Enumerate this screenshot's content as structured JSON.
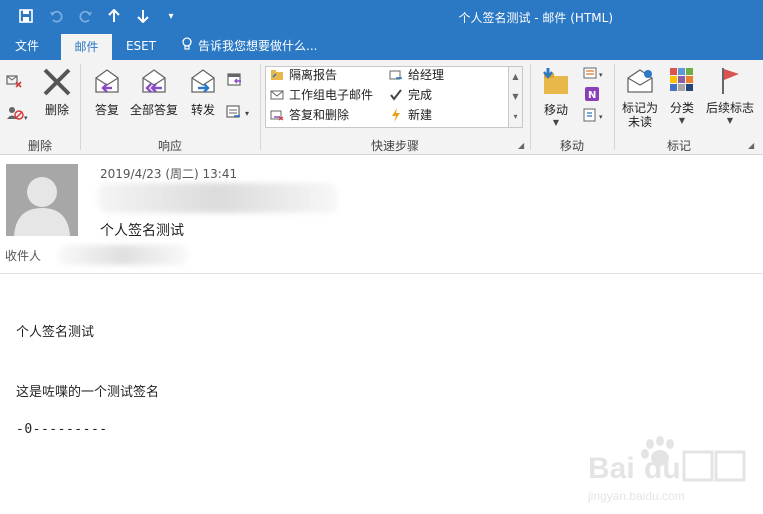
{
  "window": {
    "title": "个人签名测试 - 邮件 (HTML)"
  },
  "tabs": [
    {
      "label": "文件"
    },
    {
      "label": "邮件"
    },
    {
      "label": "ESET"
    }
  ],
  "tell_me": "告诉我您想要做什么...",
  "ribbon": {
    "delete_group": {
      "label": "删除",
      "delete_button": "删除"
    },
    "respond_group": {
      "label": "响应",
      "reply": "答复",
      "reply_all": "全部答复",
      "forward": "转发"
    },
    "quicksteps_group": {
      "label": "快速步骤",
      "items": [
        "隔离报告",
        "给经理",
        "工作组电子邮件",
        "完成",
        "答复和删除",
        "新建"
      ]
    },
    "move_group": {
      "label": "移动",
      "move_button": "移动"
    },
    "tags_group": {
      "label": "标记",
      "mark_unread_line1": "标记为",
      "mark_unread_line2": "未读",
      "categorize": "分类",
      "follow_up": "后续标志"
    }
  },
  "message": {
    "date": "2019/4/23 (周二) 13:41",
    "subject": "个人签名测试",
    "to_label": "收件人"
  },
  "body": {
    "line1": "个人签名测试",
    "line2": "这是咗喋的一个测试签名",
    "signature": "-0---------"
  },
  "colors": {
    "accent": "#2b78c5",
    "ribbon_bg": "#f3f3f3"
  }
}
